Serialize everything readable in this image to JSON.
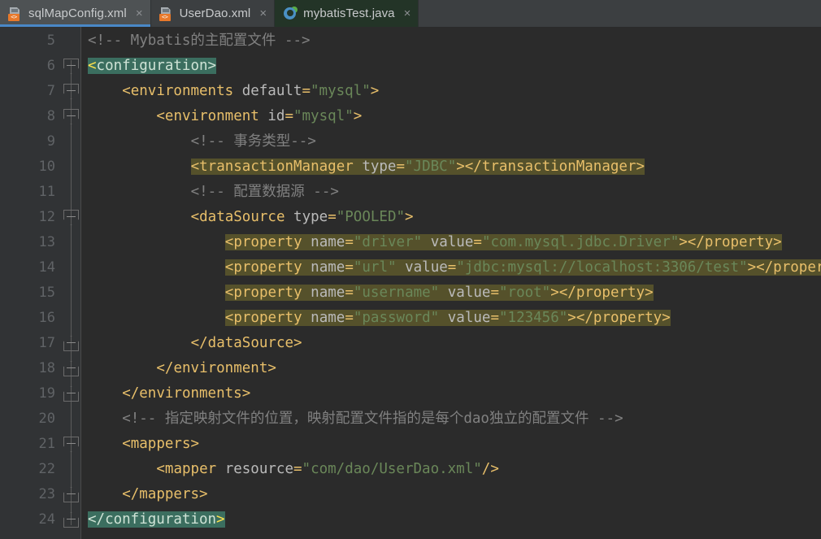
{
  "window": {
    "app": "IntelliJ IDEA Editor",
    "accent_color": "#4a88c7",
    "editor_bg": "#2b2b2b",
    "gutter_bg": "#313335",
    "tabbar_bg": "#3c3f41",
    "selection_color": "#55512b",
    "matching_bracket_color": "#3b6e5f"
  },
  "tabs": [
    {
      "label": "sqlMapConfig.xml",
      "icon": "xml-file-icon",
      "close": "×",
      "active": true,
      "green": false
    },
    {
      "label": "UserDao.xml",
      "icon": "xml-file-icon",
      "close": "×",
      "active": false,
      "green": false
    },
    {
      "label": "mybatisTest.java",
      "icon": "java-class-icon",
      "close": "×",
      "active": false,
      "green": true
    }
  ],
  "editor": {
    "first_line": 5,
    "last_line": 24,
    "line_numbers": [
      "5",
      "6",
      "7",
      "8",
      "9",
      "10",
      "11",
      "12",
      "13",
      "14",
      "15",
      "16",
      "17",
      "18",
      "19",
      "20",
      "21",
      "22",
      "23",
      "24"
    ],
    "lines": [
      {
        "num": "5",
        "indent": 0,
        "segs": [
          {
            "t": "<!-- Mybatis的主配置文件 -->",
            "c": "c-cmt"
          }
        ]
      },
      {
        "num": "6",
        "indent": 0,
        "segs": [
          {
            "t": "<",
            "c": "c-mt-br hl-match"
          },
          {
            "t": "configuration",
            "c": "c-mt-tx hl-match"
          },
          {
            "t": ">",
            "c": "c-mt-tx hl-match"
          }
        ]
      },
      {
        "num": "7",
        "indent": 2,
        "segs": [
          {
            "t": "<environments ",
            "c": "c-tag"
          },
          {
            "t": "default",
            "c": "c-atn"
          },
          {
            "t": "=",
            "c": "c-tag"
          },
          {
            "t": "\"mysql\"",
            "c": "c-atv"
          },
          {
            "t": ">",
            "c": "c-tag"
          }
        ]
      },
      {
        "num": "8",
        "indent": 4,
        "segs": [
          {
            "t": "<environment ",
            "c": "c-tag"
          },
          {
            "t": "id",
            "c": "c-atn"
          },
          {
            "t": "=",
            "c": "c-tag"
          },
          {
            "t": "\"mysql\"",
            "c": "c-atv"
          },
          {
            "t": ">",
            "c": "c-tag"
          }
        ]
      },
      {
        "num": "9",
        "indent": 6,
        "segs": [
          {
            "t": "<!-- 事务类型-->",
            "c": "c-cmt"
          }
        ]
      },
      {
        "num": "10",
        "indent": 6,
        "segs": [
          {
            "t": "<transactionManager ",
            "c": "c-tag hl-sel"
          },
          {
            "t": "type",
            "c": "c-atn hl-sel"
          },
          {
            "t": "=",
            "c": "c-tag hl-sel"
          },
          {
            "t": "\"JDBC\"",
            "c": "c-atv hl-sel"
          },
          {
            "t": "></transactionManager>",
            "c": "c-tag hl-sel"
          }
        ]
      },
      {
        "num": "11",
        "indent": 6,
        "segs": [
          {
            "t": "<!-- 配置数据源 -->",
            "c": "c-cmt"
          }
        ]
      },
      {
        "num": "12",
        "indent": 6,
        "segs": [
          {
            "t": "<dataSource ",
            "c": "c-tag"
          },
          {
            "t": "type",
            "c": "c-atn"
          },
          {
            "t": "=",
            "c": "c-tag"
          },
          {
            "t": "\"POOLED\"",
            "c": "c-atv"
          },
          {
            "t": ">",
            "c": "c-tag"
          }
        ]
      },
      {
        "num": "13",
        "indent": 8,
        "segs": [
          {
            "t": "<property ",
            "c": "c-tag hl-sel"
          },
          {
            "t": "name",
            "c": "c-atn hl-sel"
          },
          {
            "t": "=",
            "c": "c-tag hl-sel"
          },
          {
            "t": "\"driver\"",
            "c": "c-atv hl-sel"
          },
          {
            "t": " ",
            "c": "c-tag hl-sel"
          },
          {
            "t": "value",
            "c": "c-atn hl-sel"
          },
          {
            "t": "=",
            "c": "c-tag hl-sel"
          },
          {
            "t": "\"com.mysql.jdbc.Driver\"",
            "c": "c-atv hl-sel"
          },
          {
            "t": "></property>",
            "c": "c-tag hl-sel"
          }
        ]
      },
      {
        "num": "14",
        "indent": 8,
        "segs": [
          {
            "t": "<property ",
            "c": "c-tag hl-sel"
          },
          {
            "t": "name",
            "c": "c-atn hl-sel"
          },
          {
            "t": "=",
            "c": "c-tag hl-sel"
          },
          {
            "t": "\"url\"",
            "c": "c-atv hl-sel"
          },
          {
            "t": " ",
            "c": "c-tag hl-sel"
          },
          {
            "t": "value",
            "c": "c-atn hl-sel"
          },
          {
            "t": "=",
            "c": "c-tag hl-sel"
          },
          {
            "t": "\"jdbc:mysql://localhost:3306/test\"",
            "c": "c-atv hl-sel"
          },
          {
            "t": "></property>",
            "c": "c-tag hl-sel"
          }
        ]
      },
      {
        "num": "15",
        "indent": 8,
        "segs": [
          {
            "t": "<property ",
            "c": "c-tag hl-sel"
          },
          {
            "t": "name",
            "c": "c-atn hl-sel"
          },
          {
            "t": "=",
            "c": "c-tag hl-sel"
          },
          {
            "t": "\"username\"",
            "c": "c-atv hl-sel"
          },
          {
            "t": " ",
            "c": "c-tag hl-sel"
          },
          {
            "t": "value",
            "c": "c-atn hl-sel"
          },
          {
            "t": "=",
            "c": "c-tag hl-sel"
          },
          {
            "t": "\"root\"",
            "c": "c-atv hl-sel"
          },
          {
            "t": "></property>",
            "c": "c-tag hl-sel"
          }
        ]
      },
      {
        "num": "16",
        "indent": 8,
        "segs": [
          {
            "t": "<property ",
            "c": "c-tag hl-sel"
          },
          {
            "t": "name",
            "c": "c-atn hl-sel"
          },
          {
            "t": "=",
            "c": "c-tag hl-sel"
          },
          {
            "t": "\"password\"",
            "c": "c-atv hl-sel"
          },
          {
            "t": " ",
            "c": "c-tag hl-sel"
          },
          {
            "t": "value",
            "c": "c-atn hl-sel"
          },
          {
            "t": "=",
            "c": "c-tag hl-sel"
          },
          {
            "t": "\"123456\"",
            "c": "c-atv hl-sel"
          },
          {
            "t": "></property>",
            "c": "c-tag hl-sel"
          }
        ]
      },
      {
        "num": "17",
        "indent": 6,
        "segs": [
          {
            "t": "</dataSource>",
            "c": "c-tag"
          }
        ]
      },
      {
        "num": "18",
        "indent": 4,
        "segs": [
          {
            "t": "</environment>",
            "c": "c-tag"
          }
        ]
      },
      {
        "num": "19",
        "indent": 2,
        "segs": [
          {
            "t": "</environments>",
            "c": "c-tag"
          }
        ]
      },
      {
        "num": "20",
        "indent": 2,
        "segs": [
          {
            "t": "<!-- 指定映射文件的位置，映射配置文件指的是每个dao独立的配置文件 -->",
            "c": "c-cmt"
          }
        ]
      },
      {
        "num": "21",
        "indent": 2,
        "segs": [
          {
            "t": "<mappers>",
            "c": "c-tag"
          }
        ]
      },
      {
        "num": "22",
        "indent": 4,
        "segs": [
          {
            "t": "<mapper ",
            "c": "c-tag"
          },
          {
            "t": "resource",
            "c": "c-atn"
          },
          {
            "t": "=",
            "c": "c-tag"
          },
          {
            "t": "\"com/dao/UserDao.xml\"",
            "c": "c-atv"
          },
          {
            "t": "/>",
            "c": "c-tag"
          }
        ]
      },
      {
        "num": "23",
        "indent": 2,
        "segs": [
          {
            "t": "</mappers>",
            "c": "c-tag"
          }
        ]
      },
      {
        "num": "24",
        "indent": 0,
        "segs": [
          {
            "t": "</",
            "c": "c-mt-tx hl-match"
          },
          {
            "t": "configuration",
            "c": "c-mt-tx hl-match"
          },
          {
            "t": ">",
            "c": "c-mt-br hl-match"
          }
        ]
      }
    ],
    "fold_markers": [
      {
        "num": "6",
        "dir": "down"
      },
      {
        "num": "7",
        "dir": "down"
      },
      {
        "num": "8",
        "dir": "down"
      },
      {
        "num": "12",
        "dir": "down"
      },
      {
        "num": "17",
        "dir": "up"
      },
      {
        "num": "18",
        "dir": "up"
      },
      {
        "num": "19",
        "dir": "up"
      },
      {
        "num": "21",
        "dir": "down"
      },
      {
        "num": "23",
        "dir": "up"
      },
      {
        "num": "24",
        "dir": "up"
      }
    ]
  }
}
